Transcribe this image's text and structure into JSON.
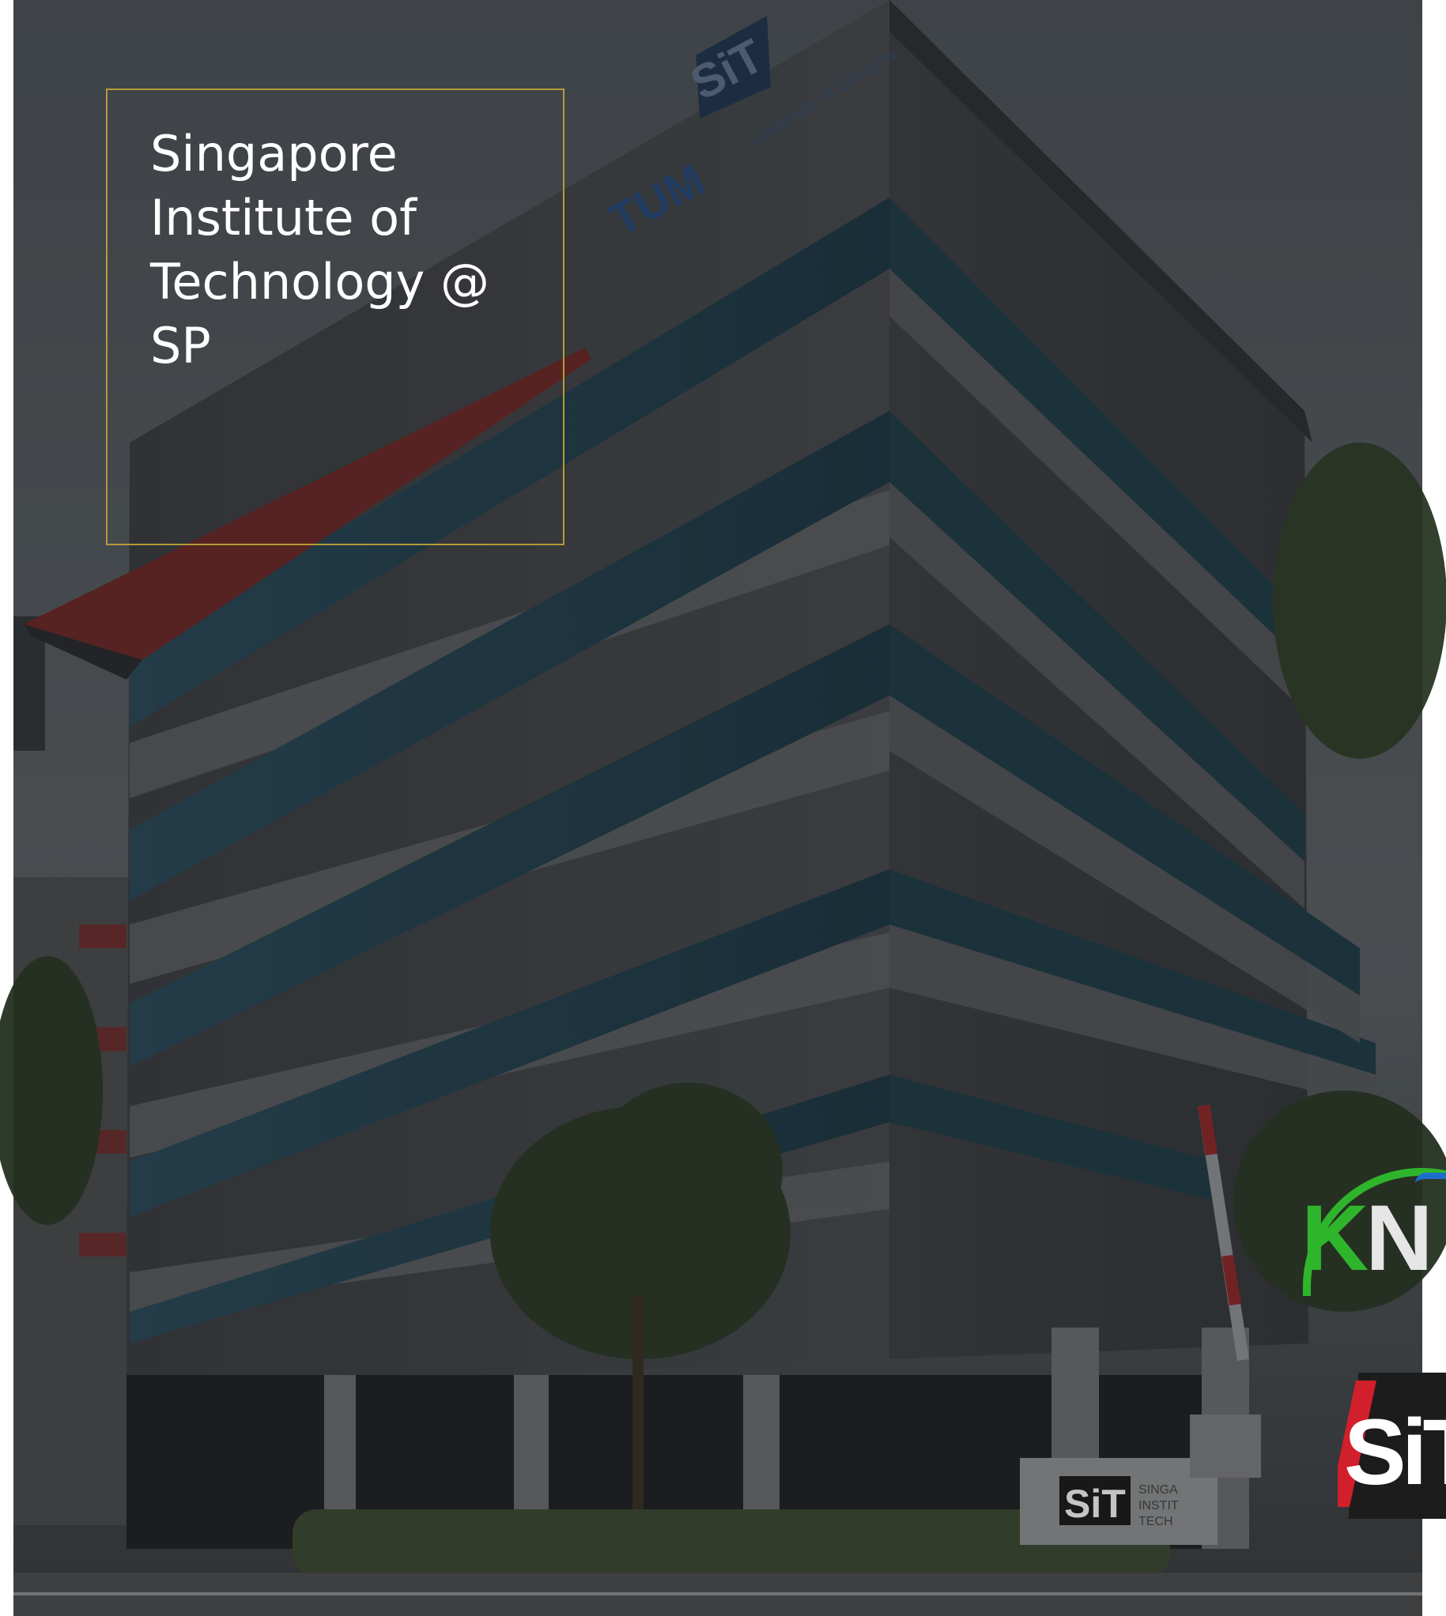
{
  "caption": {
    "title": "Singapore\nInstitute of\nTechnology @\nSP"
  },
  "photo": {
    "subject": "building",
    "signage": {
      "rooftop_logo": "SiT",
      "wall_logos": [
        "TUM Asia",
        "University of Glasgow"
      ],
      "entrance_sign": "SiT",
      "entrance_sign_text": "SINGA\nINSTIT\nTECH"
    }
  },
  "logos": {
    "kn": "KN",
    "sit": "SiT"
  },
  "colors": {
    "caption_border": "#b59a3a",
    "caption_text": "#ffffff",
    "overlay": "#000000",
    "kn_green": "#2fb52b",
    "sit_red": "#d11f2b"
  }
}
